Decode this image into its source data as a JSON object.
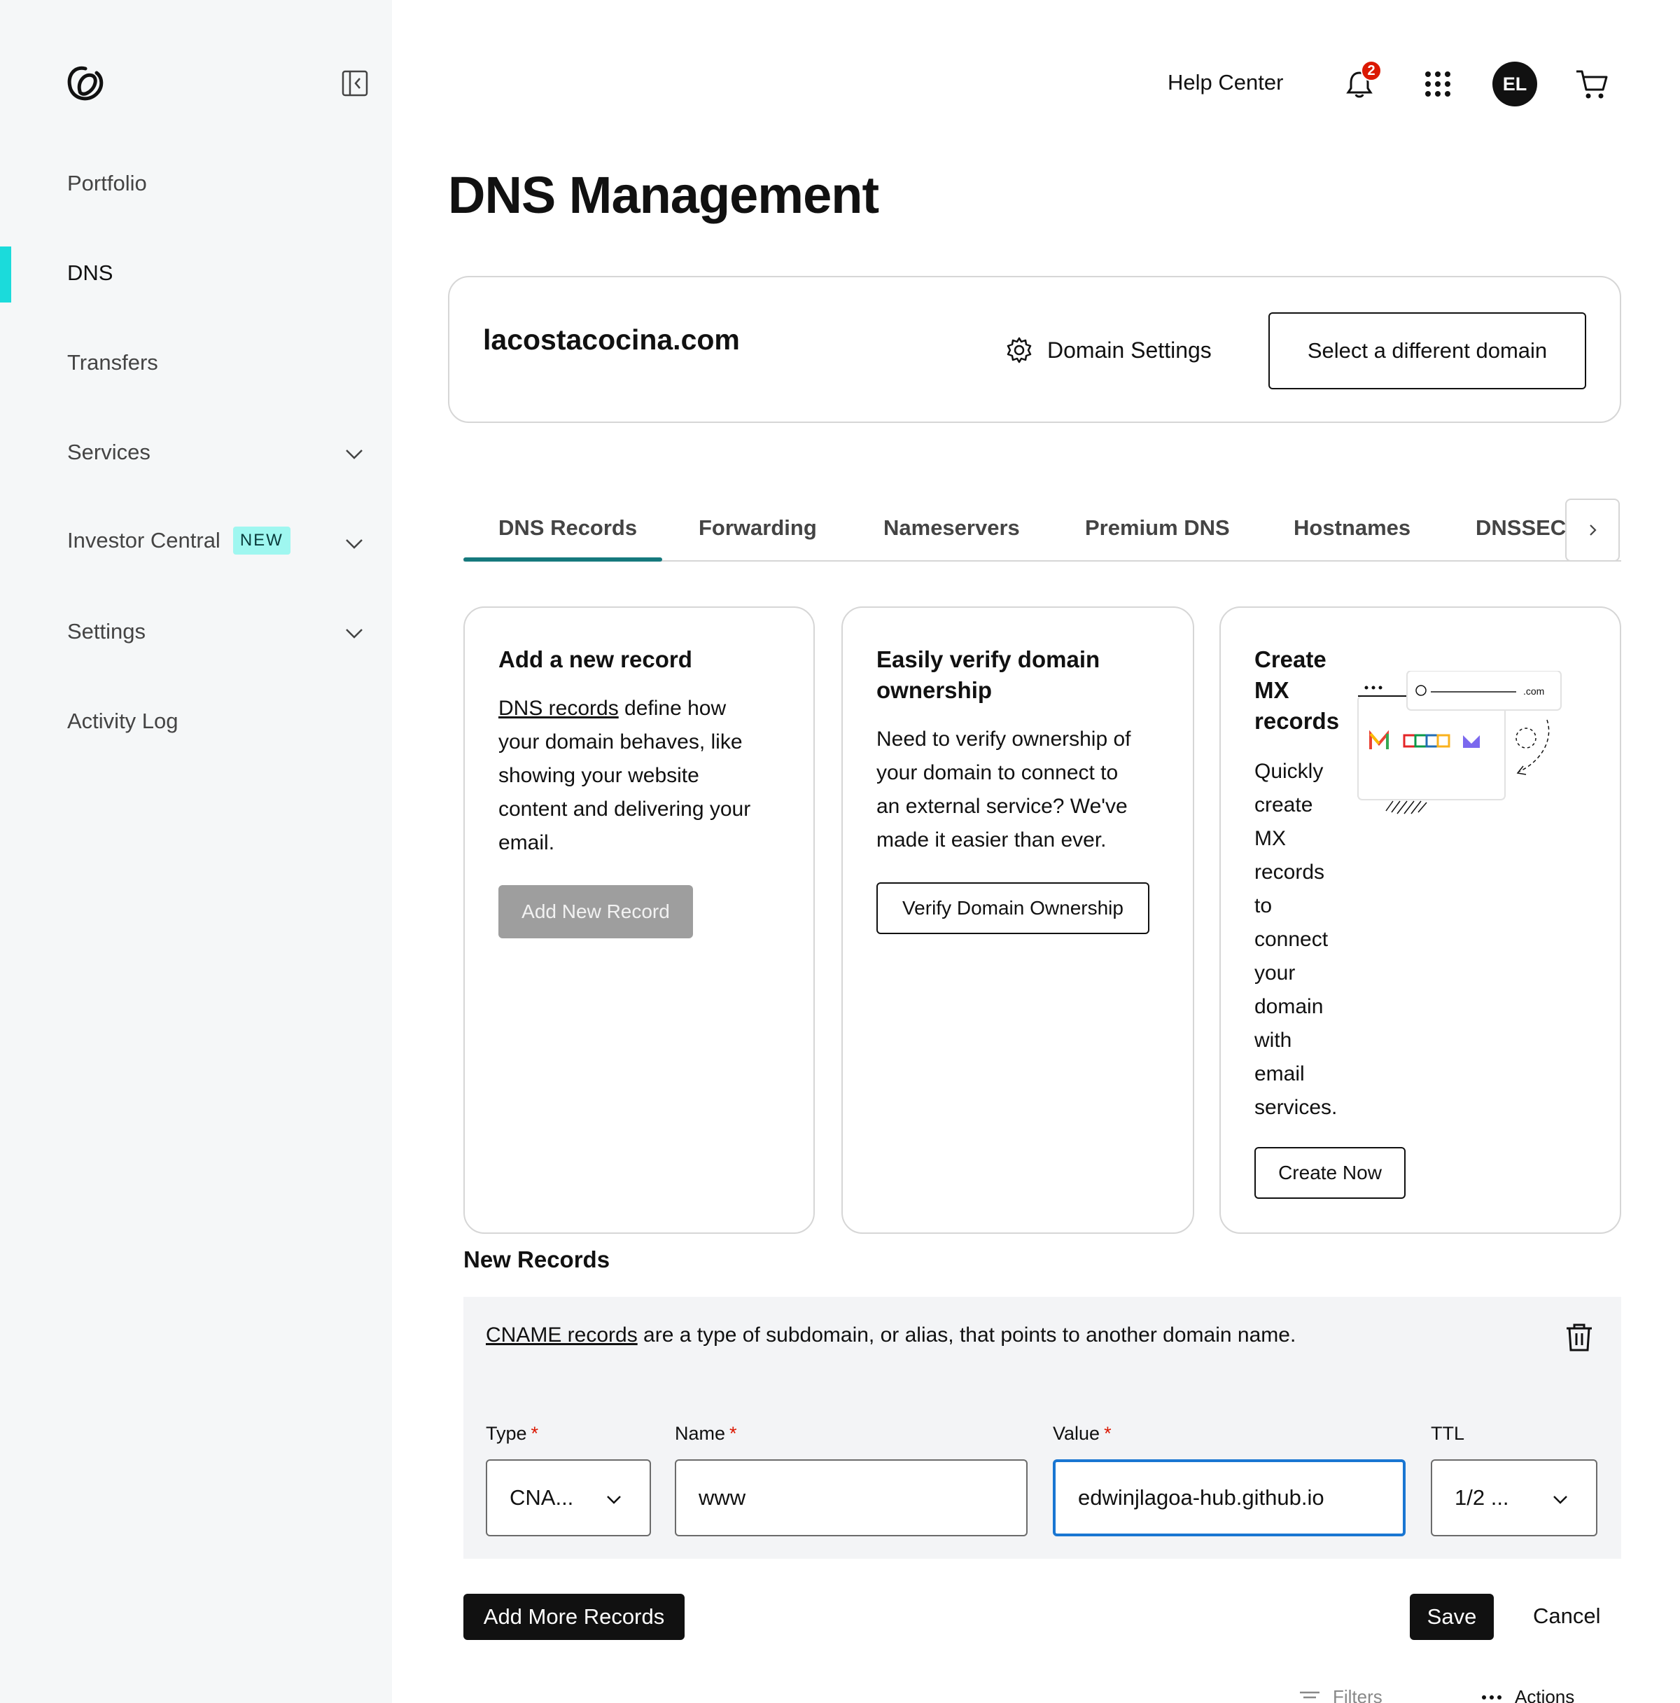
{
  "sidebar": {
    "items": [
      {
        "label": "Portfolio"
      },
      {
        "label": "DNS"
      },
      {
        "label": "Transfers"
      },
      {
        "label": "Services"
      },
      {
        "label": "Investor Central",
        "badge": "NEW"
      },
      {
        "label": "Settings"
      },
      {
        "label": "Activity Log"
      }
    ]
  },
  "header": {
    "help_center": "Help Center",
    "notification_count": "2",
    "avatar_initials": "EL"
  },
  "page": {
    "title": "DNS Management"
  },
  "domain": {
    "name": "lacostacocina.com",
    "settings_label": "Domain Settings",
    "select_label": "Select a different domain"
  },
  "tabs": [
    {
      "label": "DNS Records"
    },
    {
      "label": "Forwarding"
    },
    {
      "label": "Nameservers"
    },
    {
      "label": "Premium DNS"
    },
    {
      "label": "Hostnames"
    },
    {
      "label": "DNSSEC"
    }
  ],
  "cards": {
    "add_record": {
      "title": "Add a new record",
      "link": "DNS records",
      "text_1": " define how",
      "text_2": "your domain behaves, like",
      "text_3": "showing your website",
      "text_4": "content and delivering your",
      "text_5": "email.",
      "button": "Add New Record"
    },
    "verify": {
      "title_1": "Easily verify domain",
      "title_2": "ownership",
      "text_1": "Need to verify ownership of",
      "text_2": "your domain to connect to",
      "text_3": "an external service? We've",
      "text_4": "made it easier than ever.",
      "button": "Verify Domain Ownership"
    },
    "mx": {
      "title_1": "Create",
      "title_2": "MX",
      "title_3": "records",
      "text_lines": [
        "Quickly",
        "create",
        "MX",
        "records",
        "to",
        "connect",
        "your",
        "domain",
        "with",
        "email",
        "services."
      ],
      "button": "Create Now",
      "illustration_suffix": ".com"
    }
  },
  "new_records": {
    "title": "New Records",
    "desc_link": "CNAME records",
    "desc_text": " are a type of subdomain, or alias, that points to another domain name.",
    "type_label": "Type",
    "type_value": "CNA...",
    "name_label": "Name",
    "name_value": "www",
    "value_label": "Value",
    "value_value": "edwinjlagoa-hub.github.io",
    "ttl_label": "TTL",
    "ttl_value": "1/2 ...",
    "required_mark": "*"
  },
  "actions": {
    "add_more": "Add More Records",
    "save": "Save",
    "cancel": "Cancel",
    "filters": "Filters",
    "more_actions": "Actions"
  },
  "colors": {
    "accent_teal": "#1bdbdb",
    "tab_underline": "#16797d",
    "badge_red": "#db1802",
    "focus_blue": "#1976d2"
  }
}
